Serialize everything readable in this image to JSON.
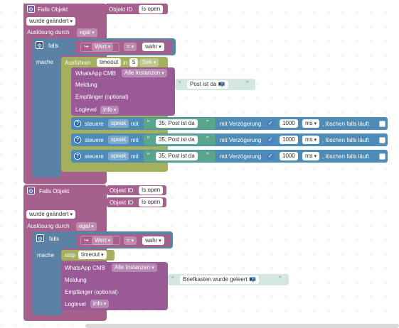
{
  "colors": {
    "event_block": "#a5608e",
    "if_block": "#5b81a5",
    "timeout_block": "#a5b05d",
    "whatsapp_block": "#9a5a96",
    "control_block": "#4e8bb7",
    "text_block": "#5ba58c",
    "string_block": "#d3e6e0"
  },
  "script1": {
    "event_label": "Falls Objekt",
    "oid_label": "Objekt ID",
    "oid_value": "Is open",
    "trigger": "wurde geändert",
    "trigger_by_label": "Auslösung durch",
    "trigger_by_value": "egal",
    "if_label": "falls",
    "then_label": "mache",
    "cond_field": "Wert",
    "cond_op": "=",
    "cond_value": "wahr",
    "run_label": "Ausführen",
    "timeout_name": "timeout",
    "in_label": "in",
    "delay": "5",
    "delay_unit": "Sek",
    "wa_label": "WhatsApp CMB",
    "wa_instance": "Alle Instanzen",
    "msg_label": "Meldung",
    "msg_text": "Post ist da 📭",
    "recipient_label": "Empfänger (optional)",
    "loglevel_label": "Loglevel",
    "loglevel_value": "info",
    "controls": [
      {
        "control_label": "steuere",
        "target": "speak",
        "with_label": "mit",
        "value": "35; Post ist da",
        "delay_label": "mit Verzögerung",
        "delay_ms": "1000",
        "unit": "ms",
        "clear_label": ", löschen falls läuft"
      },
      {
        "control_label": "steuere",
        "target": "speak",
        "with_label": "mit",
        "value": "35; Post ist da",
        "delay_label": "mit Verzögerung",
        "delay_ms": "1000",
        "unit": "ms",
        "clear_label": ", löschen falls läuft"
      },
      {
        "control_label": "steuere",
        "target": "speak",
        "with_label": "mit",
        "value": "35; Post ist da",
        "delay_label": "mit Verzögerung",
        "delay_ms": "1000",
        "unit": "ms",
        "clear_label": ", löschen falls läuft"
      }
    ]
  },
  "script2": {
    "event_label": "Falls Objekt",
    "oid_label": "Objekt ID",
    "oid_value_1": "Is open",
    "oid_value_2": "Is open",
    "trigger": "wurde geändert",
    "trigger_by_label": "Auslösung durch",
    "trigger_by_value": "egal",
    "if_label": "falls",
    "then_label": "mache",
    "cond_field": "Wert",
    "cond_op": "=",
    "cond_value": "wahr",
    "stop_label": "stop",
    "stop_value": "timeout",
    "wa_label": "WhatsApp CMB",
    "wa_instance": "Alle Instanzen",
    "msg_label": "Meldung",
    "msg_text": "Briefkasten wurde geleert 📭",
    "recipient_label": "Empfänger (optional)",
    "loglevel_label": "Loglevel",
    "loglevel_value": "info"
  }
}
